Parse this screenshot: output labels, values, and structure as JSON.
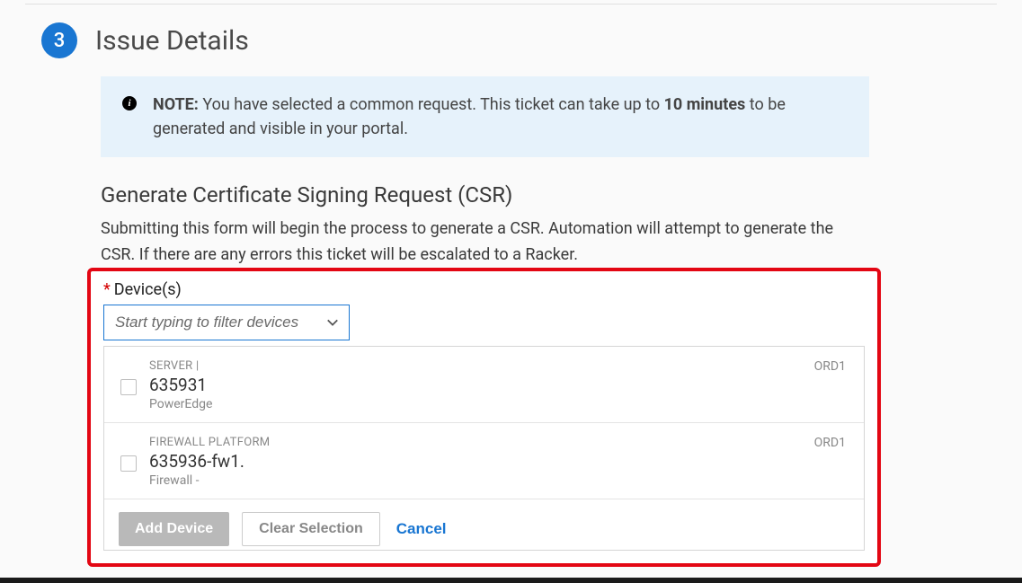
{
  "step": {
    "number": "3",
    "title": "Issue Details"
  },
  "note": {
    "label": "NOTE:",
    "pre": " You have selected a common request. This ticket can take up to ",
    "bold": "10 minutes",
    "post": " to be generated and visible in your portal."
  },
  "subsection": {
    "title": "Generate Certificate Signing Request (CSR)",
    "desc": "Submitting this form will begin the process to generate a CSR. Automation will attempt to generate the CSR. If there are any errors this ticket will be escalated to a Racker."
  },
  "devices": {
    "label": "Device(s)",
    "required_mark": "*",
    "filter_placeholder": "Start typing to filter devices",
    "items": [
      {
        "type": "SERVER |",
        "id": "635931",
        "model": "PowerEdge",
        "location": "ORD1"
      },
      {
        "type": "FIREWALL PLATFORM",
        "id": "635936-fw1.",
        "model": "Firewall -",
        "location": "ORD1"
      }
    ],
    "actions": {
      "add": "Add Device",
      "clear": "Clear Selection",
      "cancel": "Cancel"
    }
  }
}
